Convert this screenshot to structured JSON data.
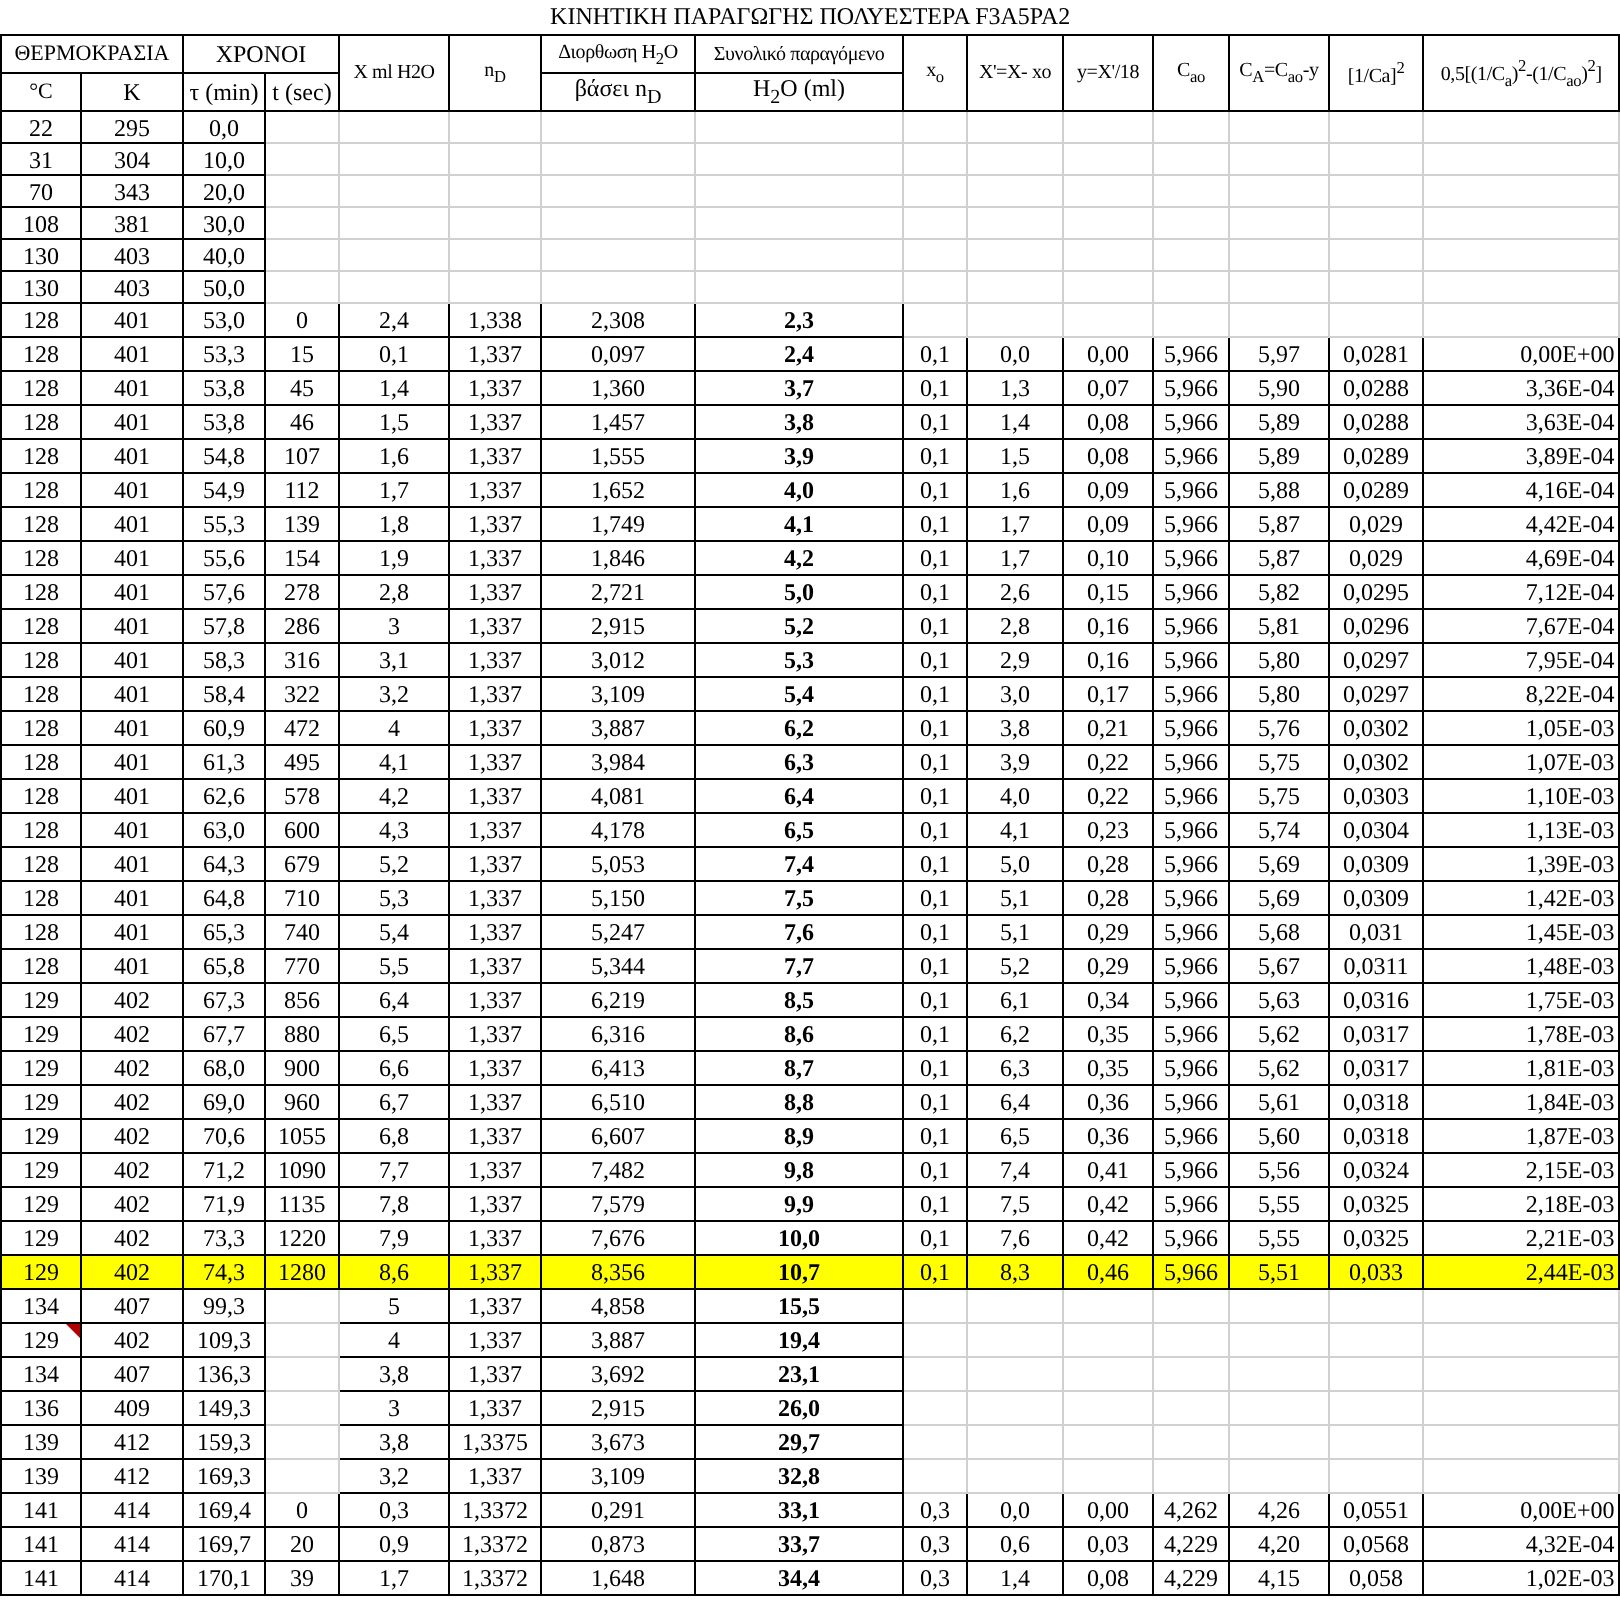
{
  "title": "ΚΙΝΗΤΙΚΗ ΠΑΡΑΓΩΓΗΣ ΠΟΛΥΕΣΤΕΡΑ F3A5PA2",
  "header_groups": [
    {
      "label": "ΘΕΡΜΟΚΡΑΣΙΑ"
    },
    {
      "label": "ΧΡΟΝΟΙ"
    }
  ],
  "subheaders": [
    "°C",
    "K",
    "τ (min)",
    "t (sec)"
  ],
  "columns": [
    {
      "top": "X ml H2O"
    },
    {
      "top": "n$_{D}$"
    },
    {
      "top": "Διορθωση H$_{2}$O",
      "bottom": "βάσει n$_{D}$"
    },
    {
      "top": "Συνολικό παραγόμενο",
      "bottom": "H$_{2}$O (ml)"
    },
    {
      "top": "x$_{o}$"
    },
    {
      "top": "X'=X- xo"
    },
    {
      "top": "y=X'/18"
    },
    {
      "top": "C$_{ao}$"
    },
    {
      "top": "C$_{A}$=C$_{ao}$-y"
    },
    {
      "top": "[1/Ca]$^{2}$"
    },
    {
      "top": "0,5[(1/C$_{a}$)$^{2}$-(1/C$_{ao}$)$^{2}$]"
    }
  ],
  "rows": [
    {
      "cells": [
        "22",
        "295",
        "0,0"
      ],
      "highlighted": false,
      "comment": false
    },
    {
      "cells": [
        "31",
        "304",
        "10,0"
      ],
      "highlighted": false,
      "comment": false
    },
    {
      "cells": [
        "70",
        "343",
        "20,0"
      ],
      "highlighted": false,
      "comment": false
    },
    {
      "cells": [
        "108",
        "381",
        "30,0"
      ],
      "highlighted": false,
      "comment": false
    },
    {
      "cells": [
        "130",
        "403",
        "40,0"
      ],
      "highlighted": false,
      "comment": false
    },
    {
      "cells": [
        "130",
        "403",
        "50,0"
      ],
      "highlighted": false,
      "comment": false
    },
    {
      "cells": [
        "128",
        "401",
        "53,0",
        "0",
        "2,4",
        "1,338",
        "2,308",
        "2,3"
      ],
      "highlighted": false,
      "comment": false
    },
    {
      "cells": [
        "128",
        "401",
        "53,3",
        "15",
        "0,1",
        "1,337",
        "0,097",
        "2,4",
        "0,1",
        "0,0",
        "0,00",
        "5,966",
        "5,97",
        "0,0281",
        "0,00E+00"
      ],
      "highlighted": false,
      "comment": false
    },
    {
      "cells": [
        "128",
        "401",
        "53,8",
        "45",
        "1,4",
        "1,337",
        "1,360",
        "3,7",
        "0,1",
        "1,3",
        "0,07",
        "5,966",
        "5,90",
        "0,0288",
        "3,36E-04"
      ],
      "highlighted": false,
      "comment": false
    },
    {
      "cells": [
        "128",
        "401",
        "53,8",
        "46",
        "1,5",
        "1,337",
        "1,457",
        "3,8",
        "0,1",
        "1,4",
        "0,08",
        "5,966",
        "5,89",
        "0,0288",
        "3,63E-04"
      ],
      "highlighted": false,
      "comment": false
    },
    {
      "cells": [
        "128",
        "401",
        "54,8",
        "107",
        "1,6",
        "1,337",
        "1,555",
        "3,9",
        "0,1",
        "1,5",
        "0,08",
        "5,966",
        "5,89",
        "0,0289",
        "3,89E-04"
      ],
      "highlighted": false,
      "comment": false
    },
    {
      "cells": [
        "128",
        "401",
        "54,9",
        "112",
        "1,7",
        "1,337",
        "1,652",
        "4,0",
        "0,1",
        "1,6",
        "0,09",
        "5,966",
        "5,88",
        "0,0289",
        "4,16E-04"
      ],
      "highlighted": false,
      "comment": false
    },
    {
      "cells": [
        "128",
        "401",
        "55,3",
        "139",
        "1,8",
        "1,337",
        "1,749",
        "4,1",
        "0,1",
        "1,7",
        "0,09",
        "5,966",
        "5,87",
        "0,029",
        "4,42E-04"
      ],
      "highlighted": false,
      "comment": false
    },
    {
      "cells": [
        "128",
        "401",
        "55,6",
        "154",
        "1,9",
        "1,337",
        "1,846",
        "4,2",
        "0,1",
        "1,7",
        "0,10",
        "5,966",
        "5,87",
        "0,029",
        "4,69E-04"
      ],
      "highlighted": false,
      "comment": false
    },
    {
      "cells": [
        "128",
        "401",
        "57,6",
        "278",
        "2,8",
        "1,337",
        "2,721",
        "5,0",
        "0,1",
        "2,6",
        "0,15",
        "5,966",
        "5,82",
        "0,0295",
        "7,12E-04"
      ],
      "highlighted": false,
      "comment": false
    },
    {
      "cells": [
        "128",
        "401",
        "57,8",
        "286",
        "3",
        "1,337",
        "2,915",
        "5,2",
        "0,1",
        "2,8",
        "0,16",
        "5,966",
        "5,81",
        "0,0296",
        "7,67E-04"
      ],
      "highlighted": false,
      "comment": false
    },
    {
      "cells": [
        "128",
        "401",
        "58,3",
        "316",
        "3,1",
        "1,337",
        "3,012",
        "5,3",
        "0,1",
        "2,9",
        "0,16",
        "5,966",
        "5,80",
        "0,0297",
        "7,95E-04"
      ],
      "highlighted": false,
      "comment": false
    },
    {
      "cells": [
        "128",
        "401",
        "58,4",
        "322",
        "3,2",
        "1,337",
        "3,109",
        "5,4",
        "0,1",
        "3,0",
        "0,17",
        "5,966",
        "5,80",
        "0,0297",
        "8,22E-04"
      ],
      "highlighted": false,
      "comment": false
    },
    {
      "cells": [
        "128",
        "401",
        "60,9",
        "472",
        "4",
        "1,337",
        "3,887",
        "6,2",
        "0,1",
        "3,8",
        "0,21",
        "5,966",
        "5,76",
        "0,0302",
        "1,05E-03"
      ],
      "highlighted": false,
      "comment": false
    },
    {
      "cells": [
        "128",
        "401",
        "61,3",
        "495",
        "4,1",
        "1,337",
        "3,984",
        "6,3",
        "0,1",
        "3,9",
        "0,22",
        "5,966",
        "5,75",
        "0,0302",
        "1,07E-03"
      ],
      "highlighted": false,
      "comment": false
    },
    {
      "cells": [
        "128",
        "401",
        "62,6",
        "578",
        "4,2",
        "1,337",
        "4,081",
        "6,4",
        "0,1",
        "4,0",
        "0,22",
        "5,966",
        "5,75",
        "0,0303",
        "1,10E-03"
      ],
      "highlighted": false,
      "comment": false
    },
    {
      "cells": [
        "128",
        "401",
        "63,0",
        "600",
        "4,3",
        "1,337",
        "4,178",
        "6,5",
        "0,1",
        "4,1",
        "0,23",
        "5,966",
        "5,74",
        "0,0304",
        "1,13E-03"
      ],
      "highlighted": false,
      "comment": false
    },
    {
      "cells": [
        "128",
        "401",
        "64,3",
        "679",
        "5,2",
        "1,337",
        "5,053",
        "7,4",
        "0,1",
        "5,0",
        "0,28",
        "5,966",
        "5,69",
        "0,0309",
        "1,39E-03"
      ],
      "highlighted": false,
      "comment": false
    },
    {
      "cells": [
        "128",
        "401",
        "64,8",
        "710",
        "5,3",
        "1,337",
        "5,150",
        "7,5",
        "0,1",
        "5,1",
        "0,28",
        "5,966",
        "5,69",
        "0,0309",
        "1,42E-03"
      ],
      "highlighted": false,
      "comment": false
    },
    {
      "cells": [
        "128",
        "401",
        "65,3",
        "740",
        "5,4",
        "1,337",
        "5,247",
        "7,6",
        "0,1",
        "5,1",
        "0,29",
        "5,966",
        "5,68",
        "0,031",
        "1,45E-03"
      ],
      "highlighted": false,
      "comment": false
    },
    {
      "cells": [
        "128",
        "401",
        "65,8",
        "770",
        "5,5",
        "1,337",
        "5,344",
        "7,7",
        "0,1",
        "5,2",
        "0,29",
        "5,966",
        "5,67",
        "0,0311",
        "1,48E-03"
      ],
      "highlighted": false,
      "comment": false
    },
    {
      "cells": [
        "129",
        "402",
        "67,3",
        "856",
        "6,4",
        "1,337",
        "6,219",
        "8,5",
        "0,1",
        "6,1",
        "0,34",
        "5,966",
        "5,63",
        "0,0316",
        "1,75E-03"
      ],
      "highlighted": false,
      "comment": false
    },
    {
      "cells": [
        "129",
        "402",
        "67,7",
        "880",
        "6,5",
        "1,337",
        "6,316",
        "8,6",
        "0,1",
        "6,2",
        "0,35",
        "5,966",
        "5,62",
        "0,0317",
        "1,78E-03"
      ],
      "highlighted": false,
      "comment": false
    },
    {
      "cells": [
        "129",
        "402",
        "68,0",
        "900",
        "6,6",
        "1,337",
        "6,413",
        "8,7",
        "0,1",
        "6,3",
        "0,35",
        "5,966",
        "5,62",
        "0,0317",
        "1,81E-03"
      ],
      "highlighted": false,
      "comment": false
    },
    {
      "cells": [
        "129",
        "402",
        "69,0",
        "960",
        "6,7",
        "1,337",
        "6,510",
        "8,8",
        "0,1",
        "6,4",
        "0,36",
        "5,966",
        "5,61",
        "0,0318",
        "1,84E-03"
      ],
      "highlighted": false,
      "comment": false
    },
    {
      "cells": [
        "129",
        "402",
        "70,6",
        "1055",
        "6,8",
        "1,337",
        "6,607",
        "8,9",
        "0,1",
        "6,5",
        "0,36",
        "5,966",
        "5,60",
        "0,0318",
        "1,87E-03"
      ],
      "highlighted": false,
      "comment": false
    },
    {
      "cells": [
        "129",
        "402",
        "71,2",
        "1090",
        "7,7",
        "1,337",
        "7,482",
        "9,8",
        "0,1",
        "7,4",
        "0,41",
        "5,966",
        "5,56",
        "0,0324",
        "2,15E-03"
      ],
      "highlighted": false,
      "comment": false
    },
    {
      "cells": [
        "129",
        "402",
        "71,9",
        "1135",
        "7,8",
        "1,337",
        "7,579",
        "9,9",
        "0,1",
        "7,5",
        "0,42",
        "5,966",
        "5,55",
        "0,0325",
        "2,18E-03"
      ],
      "highlighted": false,
      "comment": false
    },
    {
      "cells": [
        "129",
        "402",
        "73,3",
        "1220",
        "7,9",
        "1,337",
        "7,676",
        "10,0",
        "0,1",
        "7,6",
        "0,42",
        "5,966",
        "5,55",
        "0,0325",
        "2,21E-03"
      ],
      "highlighted": false,
      "comment": false
    },
    {
      "cells": [
        "129",
        "402",
        "74,3",
        "1280",
        "8,6",
        "1,337",
        "8,356",
        "10,7",
        "0,1",
        "8,3",
        "0,46",
        "5,966",
        "5,51",
        "0,033",
        "2,44E-03"
      ],
      "highlighted": true,
      "comment": false
    },
    {
      "cells": [
        "134",
        "407",
        "99,3",
        null,
        "5",
        "1,337",
        "4,858",
        "15,5"
      ],
      "highlighted": false,
      "comment": false
    },
    {
      "cells": [
        "129",
        "402",
        "109,3",
        null,
        "4",
        "1,337",
        "3,887",
        "19,4"
      ],
      "highlighted": false,
      "comment": true
    },
    {
      "cells": [
        "134",
        "407",
        "136,3",
        null,
        "3,8",
        "1,337",
        "3,692",
        "23,1"
      ],
      "highlighted": false,
      "comment": false
    },
    {
      "cells": [
        "136",
        "409",
        "149,3",
        null,
        "3",
        "1,337",
        "2,915",
        "26,0"
      ],
      "highlighted": false,
      "comment": false
    },
    {
      "cells": [
        "139",
        "412",
        "159,3",
        null,
        "3,8",
        "1,3375",
        "3,673",
        "29,7"
      ],
      "highlighted": false,
      "comment": false
    },
    {
      "cells": [
        "139",
        "412",
        "169,3",
        null,
        "3,2",
        "1,337",
        "3,109",
        "32,8"
      ],
      "highlighted": false,
      "comment": false
    },
    {
      "cells": [
        "141",
        "414",
        "169,4",
        "0",
        "0,3",
        "1,3372",
        "0,291",
        "33,1",
        "0,3",
        "0,0",
        "0,00",
        "4,262",
        "4,26",
        "0,0551",
        "0,00E+00"
      ],
      "highlighted": false,
      "comment": false
    },
    {
      "cells": [
        "141",
        "414",
        "169,7",
        "20",
        "0,9",
        "1,3372",
        "0,873",
        "33,7",
        "0,3",
        "0,6",
        "0,03",
        "4,229",
        "4,20",
        "0,0568",
        "4,32E-04"
      ],
      "highlighted": false,
      "comment": false
    },
    {
      "cells": [
        "141",
        "414",
        "170,1",
        "39",
        "1,7",
        "1,3372",
        "1,648",
        "34,4",
        "0,3",
        "1,4",
        "0,08",
        "4,229",
        "4,15",
        "0,058",
        "1,02E-03"
      ],
      "highlighted": false,
      "comment": false
    }
  ]
}
